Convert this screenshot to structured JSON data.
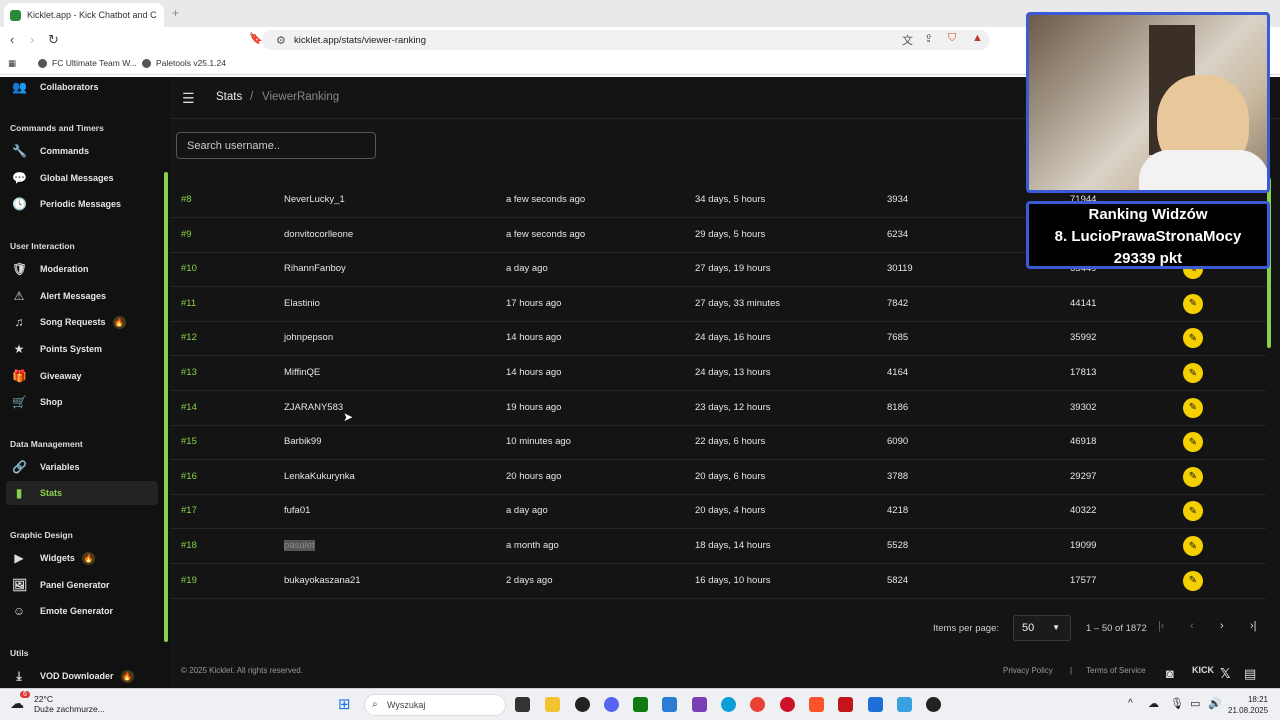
{
  "browser": {
    "tab_title": "Kicklet.app - Kick Chatbot and C",
    "url": "kicklet.app/stats/viewer-ranking",
    "bookmarks": [
      "FC Ultimate Team W...",
      "Paletools v25.1.24"
    ]
  },
  "sidebar": {
    "top_item": "Collaborators",
    "sections": [
      {
        "title": "Commands and Timers",
        "items": [
          "Commands",
          "Global Messages",
          "Periodic Messages"
        ]
      },
      {
        "title": "User Interaction",
        "items": [
          "Moderation",
          "Alert Messages",
          "Song Requests",
          "Points System",
          "Giveaway",
          "Shop"
        ]
      },
      {
        "title": "Data Management",
        "items": [
          "Variables",
          "Stats"
        ]
      },
      {
        "title": "Graphic Design",
        "items": [
          "Widgets",
          "Panel Generator",
          "Emote Generator"
        ]
      },
      {
        "title": "Utils",
        "items": [
          "VOD Downloader"
        ]
      }
    ],
    "active_item": "Stats"
  },
  "header": {
    "crumb_root": "Stats",
    "separator": "/",
    "crumb_current": "ViewerRanking"
  },
  "search": {
    "placeholder": "Search username.."
  },
  "table": {
    "rows": [
      {
        "rank": "#8",
        "user": "NeverLucky_1",
        "last_seen": "a few seconds ago",
        "watchtime": "34 days, 5 hours",
        "messages": "3934",
        "points": "71944"
      },
      {
        "rank": "#9",
        "user": "donvitocorlleone",
        "last_seen": "a few seconds ago",
        "watchtime": "29 days, 5 hours",
        "messages": "6234",
        "points": ""
      },
      {
        "rank": "#10",
        "user": "RihannFanboy",
        "last_seen": "a day ago",
        "watchtime": "27 days, 19 hours",
        "messages": "30119",
        "points": "65449"
      },
      {
        "rank": "#11",
        "user": "Elastinio",
        "last_seen": "17 hours ago",
        "watchtime": "27 days, 33 minutes",
        "messages": "7842",
        "points": "44141"
      },
      {
        "rank": "#12",
        "user": "johnpepson",
        "last_seen": "14 hours ago",
        "watchtime": "24 days, 16 hours",
        "messages": "7685",
        "points": "35992"
      },
      {
        "rank": "#13",
        "user": "MiffinQE",
        "last_seen": "14 hours ago",
        "watchtime": "24 days, 13 hours",
        "messages": "4164",
        "points": "17813"
      },
      {
        "rank": "#14",
        "user": "ZJARANY583",
        "last_seen": "19 hours ago",
        "watchtime": "23 days, 12 hours",
        "messages": "8186",
        "points": "39302"
      },
      {
        "rank": "#15",
        "user": "Barbik99",
        "last_seen": "10 minutes ago",
        "watchtime": "22 days, 6 hours",
        "messages": "6090",
        "points": "46918"
      },
      {
        "rank": "#16",
        "user": "LenkaKukurynka",
        "last_seen": "20 hours ago",
        "watchtime": "20 days, 6 hours",
        "messages": "3788",
        "points": "29297"
      },
      {
        "rank": "#17",
        "user": "fufa01",
        "last_seen": "a day ago",
        "watchtime": "20 days, 4 hours",
        "messages": "4218",
        "points": "40322"
      },
      {
        "rank": "#18",
        "user": "pasulet",
        "last_seen": "a month ago",
        "watchtime": "18 days, 14 hours",
        "messages": "5528",
        "points": "19099"
      },
      {
        "rank": "#19",
        "user": "bukayokaszana21",
        "last_seen": "2 days ago",
        "watchtime": "16 days, 10 hours",
        "messages": "5824",
        "points": "17577"
      }
    ]
  },
  "pager": {
    "items_label": "Items per page:",
    "per_page": "50",
    "range": "1 – 50 of 1872"
  },
  "footer": {
    "copyright": "© 2025 Kicklet. All rights reserved.",
    "privacy": "Privacy Policy",
    "sep": "|",
    "terms": "Terms of Service",
    "brand": "KICK"
  },
  "overlay": {
    "title": "Ranking Widzów",
    "line2": "8. LucioPrawaStronaMocy",
    "line3": "29339 pkt"
  },
  "taskbar": {
    "temp": "22°C",
    "weather": "Duże zachmurze...",
    "search": "Wyszukaj",
    "time": "18:21",
    "date": "21.08.2025",
    "badge": "6"
  },
  "accent": "#8ad14a",
  "edit_color": "#f5d000"
}
